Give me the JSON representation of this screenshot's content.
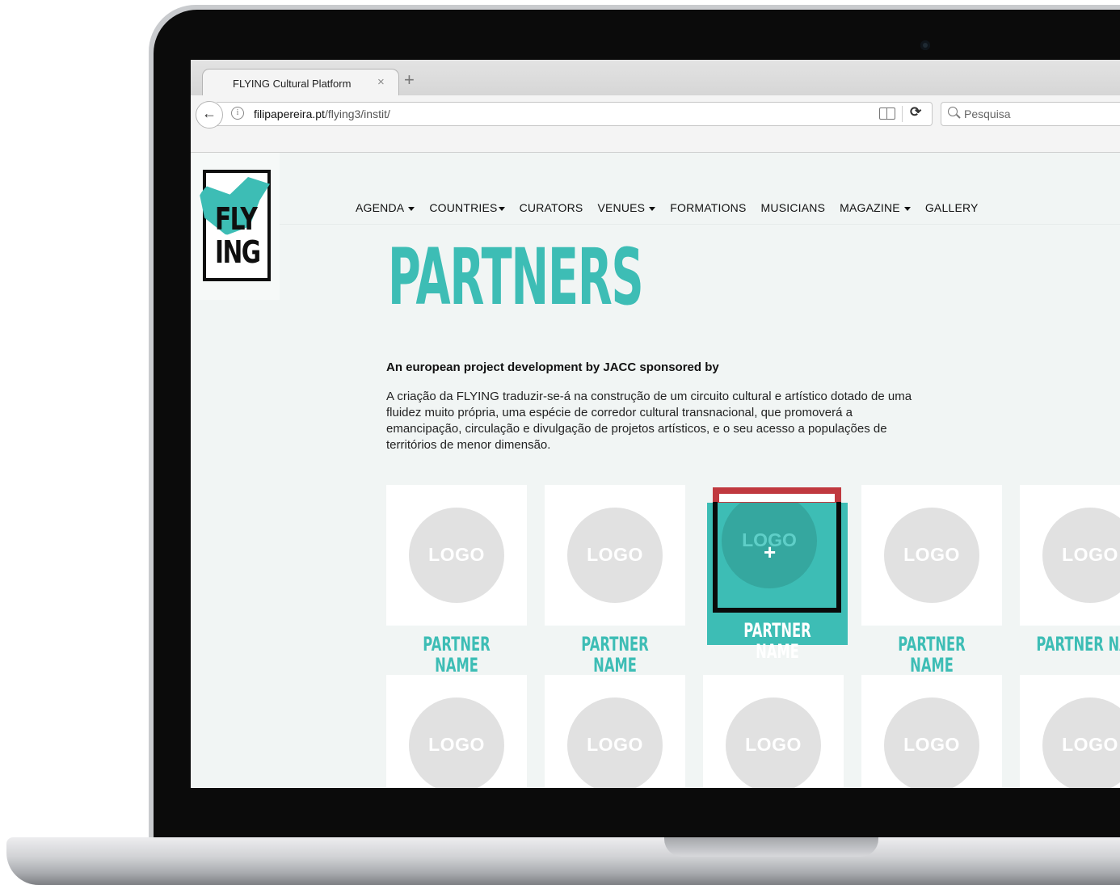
{
  "browser": {
    "tab_title": "FLYING Cultural Platform",
    "tab_close": "×",
    "new_tab": "+",
    "url_host": "filipapereira.pt",
    "url_path": "/flying3/instit/",
    "search_placeholder": "Pesquisa"
  },
  "site": {
    "logo_line1": "FLY",
    "logo_line2": "ING",
    "menu": [
      {
        "label": "AGENDA",
        "dropdown": true
      },
      {
        "label": "COUNTRIES",
        "dropdown": true
      },
      {
        "label": "CURATORS",
        "dropdown": false
      },
      {
        "label": "VENUES",
        "dropdown": true
      },
      {
        "label": "FORMATIONS",
        "dropdown": false
      },
      {
        "label": "MUSICIANS",
        "dropdown": false
      },
      {
        "label": "MAGAZINE",
        "dropdown": true
      },
      {
        "label": "GALLERY",
        "dropdown": false
      }
    ]
  },
  "main": {
    "title": "PARTNERS",
    "intro_heading": "An european project development by JACC sponsored by",
    "intro_body": "A criação da FLYING traduzir-se-á na construção de um circuito cultural e artístico dotado de uma fluidez muito própria, uma espécie de corredor cultural transnacional, que promoverá a emancipação, circulação e divulgação de projetos artísticos, e o seu acesso a populações de territórios de menor dimensão.",
    "logo_placeholder": "LOGO",
    "plus": "+",
    "partner_name": "PARTNER NAME",
    "partner_name_cut": "PARTNER NAI"
  },
  "colors": {
    "accent": "#3dbdb5",
    "hover_red": "#c0393f",
    "placeholder_gray": "#e1e1e1",
    "background": "#f1f5f4"
  }
}
